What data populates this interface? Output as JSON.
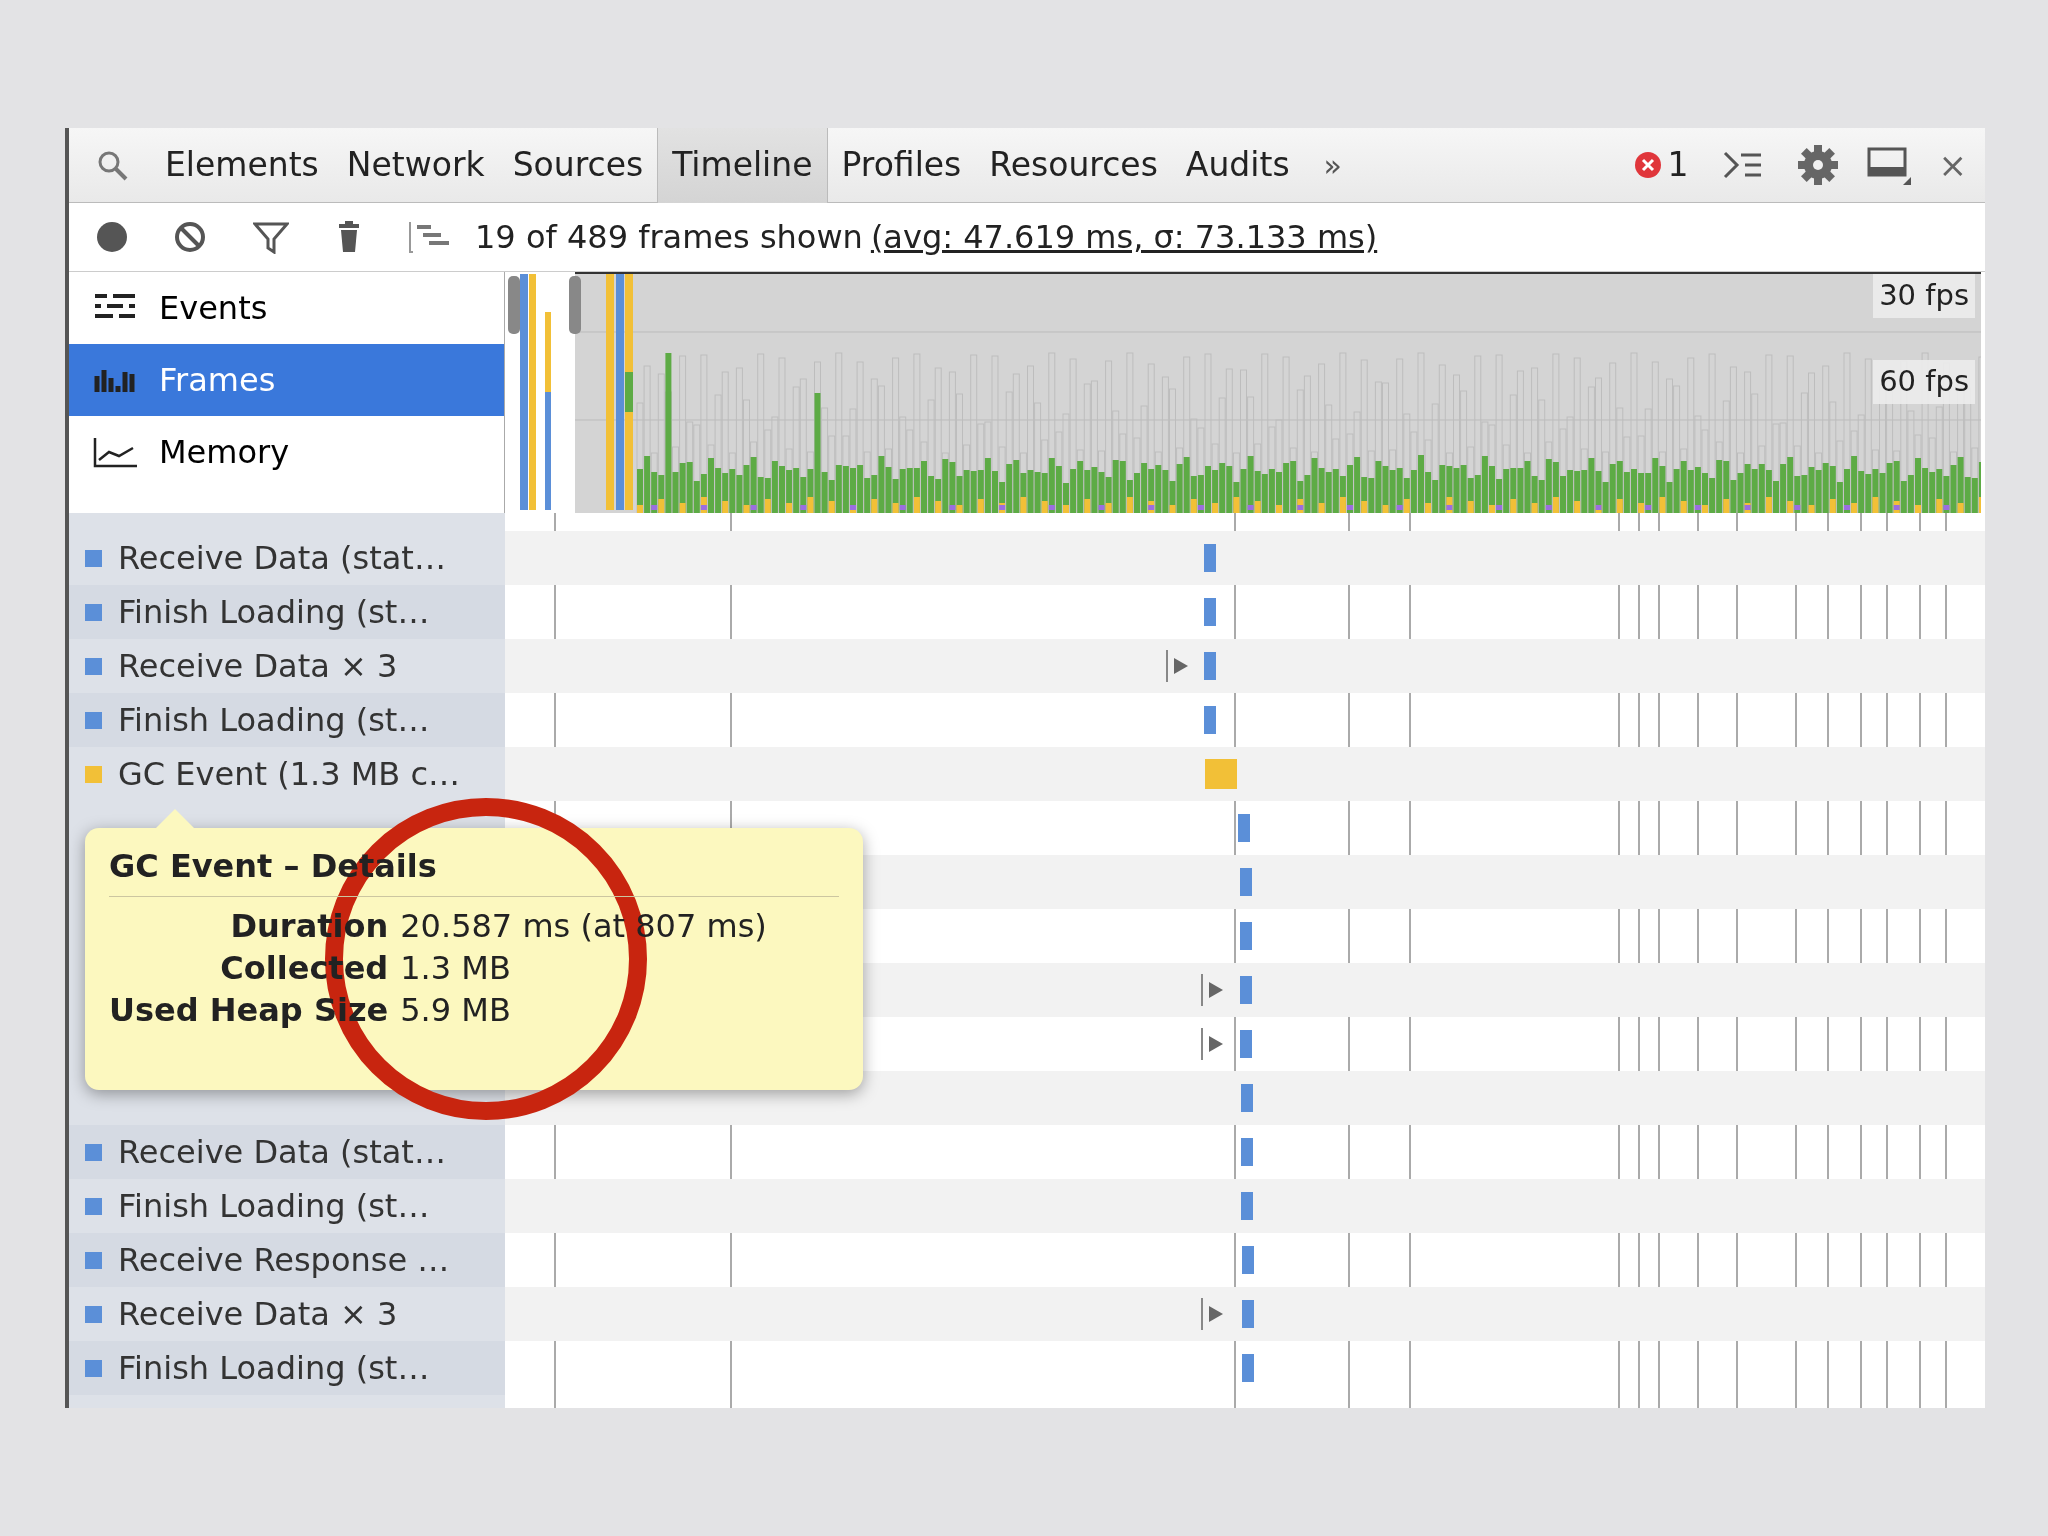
{
  "tabs": [
    {
      "label": "Elements",
      "selected": false
    },
    {
      "label": "Network",
      "selected": false
    },
    {
      "label": "Sources",
      "selected": false
    },
    {
      "label": "Timeline",
      "selected": true
    },
    {
      "label": "Profiles",
      "selected": false
    },
    {
      "label": "Resources",
      "selected": false
    },
    {
      "label": "Audits",
      "selected": false
    }
  ],
  "overflow": "»",
  "error_count": "1",
  "close": "×",
  "toolbar": {
    "summary": "19 of 489 frames shown",
    "stats": "(avg: 47.619 ms, σ: 73.133 ms)"
  },
  "views": [
    {
      "label": "Events",
      "kind": "events",
      "selected": false
    },
    {
      "label": "Frames",
      "kind": "frames",
      "selected": true
    },
    {
      "label": "Memory",
      "kind": "memory",
      "selected": false
    }
  ],
  "fps_labels": [
    "30 fps",
    "60 fps"
  ],
  "records": [
    {
      "label": "Receive Data (stat…",
      "color": "#5b8fd8",
      "expandable": false
    },
    {
      "label": "Finish Loading (st…",
      "color": "#5b8fd8",
      "expandable": false
    },
    {
      "label": "Receive Data × 3",
      "color": "#5b8fd8",
      "expandable": true
    },
    {
      "label": "Finish Loading (st…",
      "color": "#5b8fd8",
      "expandable": false
    },
    {
      "label": "GC Event (1.3 MB c…",
      "color": "#f2c037",
      "expandable": false
    },
    {
      "color": "#5b8fd8",
      "expandable": false
    },
    {
      "color": "#5b8fd8",
      "expandable": false
    },
    {
      "color": "#5b8fd8",
      "expandable": false
    },
    {
      "color": "#5b8fd8",
      "expandable": true
    },
    {
      "color": "#5b8fd8",
      "expandable": true
    },
    {
      "color": "#5b8fd8",
      "expandable": false
    },
    {
      "label": "Receive Data (stat…",
      "color": "#5b8fd8",
      "expandable": false
    },
    {
      "label": "Finish Loading (st…",
      "color": "#5b8fd8",
      "expandable": false
    },
    {
      "label": "Receive Response …",
      "color": "#5b8fd8",
      "expandable": false
    },
    {
      "label": "Receive Data × 3",
      "color": "#5b8fd8",
      "expandable": true
    },
    {
      "label": "Finish Loading (st…",
      "color": "#5b8fd8",
      "expandable": false
    }
  ],
  "tooltip": {
    "title": "GC Event – Details",
    "rows": [
      {
        "label": "Duration",
        "value": "20.587 ms (at 807 ms)"
      },
      {
        "label": "Collected",
        "value": "1.3 MB"
      },
      {
        "label": "Used Heap Size",
        "value": "5.9 MB"
      }
    ]
  }
}
